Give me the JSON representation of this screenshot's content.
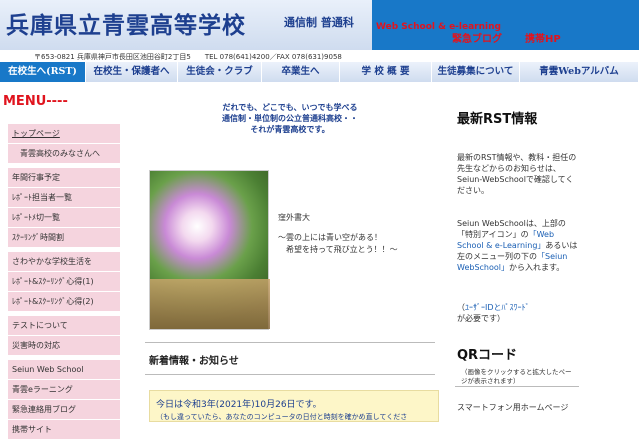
{
  "header": {
    "school_name": "兵庫県立青雲高等学校",
    "school_sub": "通信制 普通科",
    "address": "〒653-0821 兵庫県神戸市長田区池田谷町2丁目5　　TEL 078(641)4200／FAX 078(631)9058",
    "links": {
      "web_school": "Web School & e-learning",
      "blog": "緊急ブログ",
      "mobile": "携帯HP"
    }
  },
  "nav": {
    "items": [
      "在校生へ(RST)",
      "在校生・保護者へ",
      "生徒会・クラブ",
      "卒業生へ",
      "学 校 概 要",
      "生徒募集について",
      "青雲Webアルバム"
    ]
  },
  "sidebar": {
    "title": "MENU----",
    "items": [
      "トップページ",
      "青雲高校のみなさんへ",
      "年間行事予定",
      "ﾚﾎﾟｰﾄ担当者一覧",
      "ﾚﾎﾟｰﾄﾒ切一覧",
      "ｽｸｰﾘﾝｸﾞ時間割",
      "さわやかな学校生活を",
      "ﾚﾎﾟｰﾄ&ｽｸｰﾘﾝｸﾞ心得(1)",
      "ﾚﾎﾟｰﾄ&ｽｸｰﾘﾝｸﾞ心得(2)",
      "テストについて",
      "災害時の対応",
      "Seiun Web School",
      "青雲eラーニング",
      "緊急連絡用ブログ",
      "携帯サイト"
    ]
  },
  "main": {
    "intro": [
      "だれでも、どこでも、いつでも学べる",
      "通信制・単位制の公立普通科高校・・",
      "それが青雲高校です。"
    ],
    "poem_title": "窪外書大",
    "poem_lines": [
      "～雲の上には青い空がある！",
      "希望を持って飛び立とう！！～"
    ],
    "news_title": "新着情報・お知らせ",
    "notice_line1": "今日は令和3年(2021年)10月26日です。",
    "notice_line2": "（もし違っていたら、あなたのコンピュータの日付と時刻を確かめ直してくださ"
  },
  "right": {
    "rst_title": "最新RST情報",
    "rst_p1": "最新のRST情報や、教科・担任の先生などからのお知らせは、Seiun-WebSchoolで確認してください。",
    "rst_p2a": "Seiun WebSchoolは、上部の「特別アイコン」の",
    "rst_p2b": "「Web School & e-Learning」",
    "rst_p2c": "あるいは左のメニュー列の下の",
    "rst_p2d": "「Seiun WebSchool」",
    "rst_p2e": "から入れます。",
    "rst_p3a": "（",
    "rst_p3b": "ﾕｰｻﾞｰIDとﾊﾟｽﾜｰﾄﾞ",
    "rst_p3c": "が必要です）",
    "qr_title": "QRコード",
    "qr_note": "（画像をクリックすると拡大したページが表示されます）",
    "sp_label": "スマートフォン用ホームページ"
  },
  "colors": {
    "accent_blue": "#1878c8",
    "title_blue": "#1d3f8f",
    "menu_pink": "#f5d4de",
    "alert_red": "#e0141e",
    "notice_yellow": "#fdf6c8"
  }
}
